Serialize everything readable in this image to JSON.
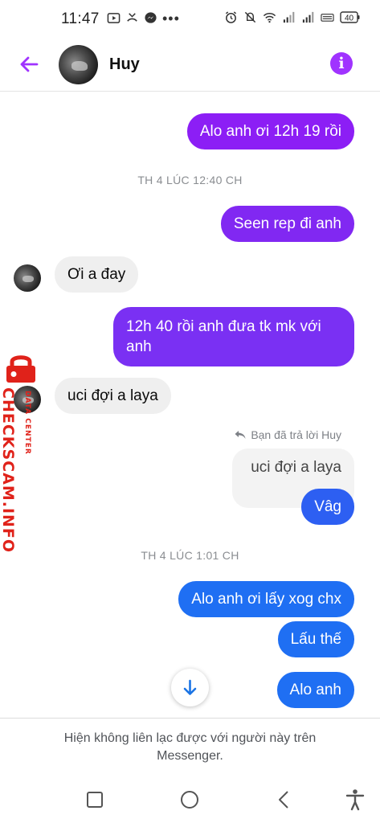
{
  "status_bar": {
    "time": "11:47",
    "battery": "40",
    "left_icons": [
      "youtube-icon",
      "missed-call-icon",
      "messenger-icon",
      "more-dots-icon"
    ],
    "right_icons": [
      "alarm-icon",
      "mute-icon",
      "wifi-icon",
      "signal-icon",
      "signal-icon",
      "volte-icon",
      "battery-icon"
    ]
  },
  "header": {
    "name": "Huy",
    "back_icon": "arrow-left-icon",
    "info_icon": "info-icon",
    "accent_color": "#a033ff"
  },
  "messages": [
    {
      "kind": "outgoing",
      "text": "Alo anh ơi 12h 19 rồi"
    },
    {
      "kind": "timestamp",
      "text": "TH 4 LÚC 12:40 CH"
    },
    {
      "kind": "outgoing",
      "text": "Seen rep đi anh"
    },
    {
      "kind": "incoming",
      "text": "Ơi a đay"
    },
    {
      "kind": "outgoing",
      "lines": [
        "12h 40 rồi anh đưa tk mk với",
        "anh"
      ]
    },
    {
      "kind": "incoming",
      "text": "uci đợi a laya"
    },
    {
      "kind": "reply_note",
      "text": "Bạn đã trả lời Huy"
    },
    {
      "kind": "quoted",
      "text": "uci đợi a laya"
    },
    {
      "kind": "outgoing",
      "text": "Vâg"
    },
    {
      "kind": "timestamp",
      "text": "TH 4 LÚC 1:01 CH"
    },
    {
      "kind": "outgoing",
      "text": "Alo anh ơi lấy xog chx"
    },
    {
      "kind": "outgoing",
      "text": "Lấu thế"
    },
    {
      "kind": "outgoing",
      "text": "Alo anh"
    }
  ],
  "footer": {
    "notice": "Hiện không liên lạc được với người này trên Messenger."
  },
  "nav": {
    "recents_icon": "square-icon",
    "home_icon": "circle-icon",
    "back_icon": "triangle-back-icon",
    "accessibility_icon": "accessibility-icon"
  },
  "watermark": {
    "brand": "CHECKSCAM.INFO",
    "sub": "DATA CENTER",
    "color": "#e0221a"
  },
  "colors": {
    "purple": "#8c1ef5",
    "violet": "#7a30f3",
    "blue": "#1f6ff3",
    "incoming": "#efefef"
  }
}
